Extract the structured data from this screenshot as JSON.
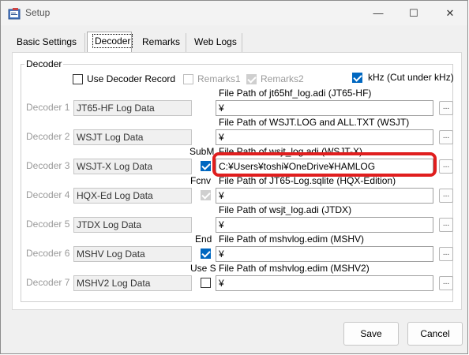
{
  "window": {
    "title": "Setup",
    "minimize_icon": "minimize-icon",
    "maximize_icon": "maximize-icon",
    "close_icon": "close-icon"
  },
  "tabs": [
    {
      "label": "Basic Settings",
      "active": false
    },
    {
      "label": "Decoder",
      "active": true
    },
    {
      "label": "Remarks",
      "active": false
    },
    {
      "label": "Web Logs",
      "active": false
    }
  ],
  "group": {
    "title": "Decoder",
    "use_decoder_record": {
      "label": "Use Decoder Record",
      "checked": false
    },
    "remarks1": {
      "label": "Remarks1",
      "checked": false,
      "enabled": false
    },
    "remarks2": {
      "label": "Remarks2",
      "checked": true,
      "enabled": false
    },
    "khz": {
      "label": "kHz (Cut under kHz)",
      "checked": true
    }
  },
  "decoders": [
    {
      "label": "Decoder 1",
      "name": "JT65-HF Log Data",
      "path_label": "File Path of jt65hf_log.adi (JT65-HF)",
      "path": "¥",
      "option_label": "",
      "option_checkbox": "none"
    },
    {
      "label": "Decoder 2",
      "name": "WSJT Log Data",
      "path_label": "File Path of WSJT.LOG and ALL.TXT (WSJT)",
      "path": "¥",
      "option_label": "",
      "option_checkbox": "none"
    },
    {
      "label": "Decoder 3",
      "name": "WSJT-X Log Data",
      "path_label": "File Path of wsjt_log.adi (WSJT-X)",
      "path": "C:¥Users¥toshi¥OneDrive¥HAMLOG",
      "option_label": "SubM",
      "option_checkbox": "on"
    },
    {
      "label": "Decoder 4",
      "name": "HQX-Ed Log Data",
      "path_label": "File Path of JT65-Log.sqlite (HQX-Edition)",
      "path": "¥",
      "option_label": "Fcnv",
      "option_checkbox": "disabled"
    },
    {
      "label": "Decoder 5",
      "name": "JTDX Log Data",
      "path_label": "File Path of wsjt_log.adi (JTDX)",
      "path": "¥",
      "option_label": "",
      "option_checkbox": "none"
    },
    {
      "label": "Decoder 6",
      "name": "MSHV Log Data",
      "path_label": "File Path of mshvlog.edim (MSHV)",
      "path": "¥",
      "option_label": "End",
      "option_checkbox": "on"
    },
    {
      "label": "Decoder 7",
      "name": "MSHV2 Log Data",
      "path_label": "File Path of mshvlog.edim (MSHV2)",
      "path": "¥",
      "option_label": "Use S",
      "option_checkbox": "off"
    }
  ],
  "browse_label": "...",
  "buttons": {
    "save": "Save",
    "cancel": "Cancel"
  }
}
